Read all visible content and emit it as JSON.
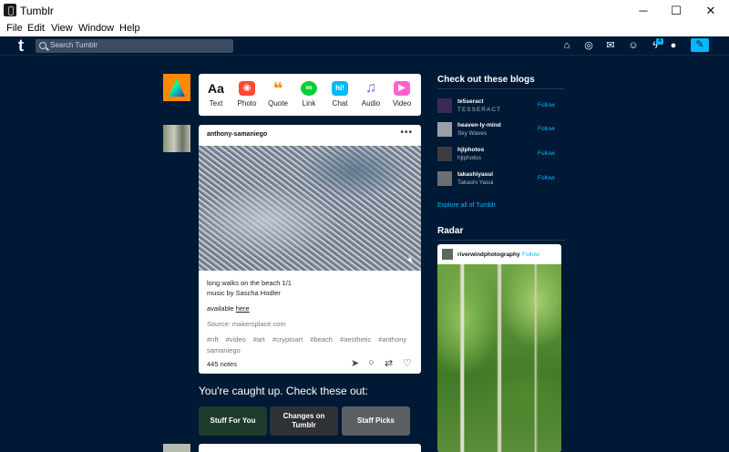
{
  "window": {
    "title": "Tumblr",
    "controls": {
      "minimize": "─",
      "maximize": "☐",
      "close": "✕"
    }
  },
  "menu": [
    "File",
    "Edit",
    "View",
    "Window",
    "Help"
  ],
  "topbar": {
    "logo": "t",
    "search_placeholder": "Search Tumblr",
    "nav_icons": [
      "home-icon",
      "explore-icon",
      "inbox-icon",
      "messages-icon",
      "activity-icon",
      "account-icon",
      "compose-icon"
    ],
    "activity_badge": "4"
  },
  "composer": {
    "items": [
      {
        "label": "Text",
        "glyph": "Aa",
        "color": "#111111"
      },
      {
        "label": "Photo",
        "glyph": "◉",
        "color": "#ff4930"
      },
      {
        "label": "Quote",
        "glyph": "❝",
        "color": "#ff8a00"
      },
      {
        "label": "Link",
        "glyph": "∞",
        "color": "#00cf35"
      },
      {
        "label": "Chat",
        "glyph": "hi!",
        "color": "#00b8ff"
      },
      {
        "label": "Audio",
        "glyph": "♫",
        "color": "#7c5cff"
      },
      {
        "label": "Video",
        "glyph": "▶",
        "color": "#ff62ce"
      }
    ]
  },
  "post": {
    "username": "anthony-samaniego",
    "line1": "long walks on the beach 1/1",
    "line2": "music by Sascha Hodler",
    "available_prefix": "available",
    "available_link": "here",
    "source": "Source: makersplace.com",
    "tags": [
      "#nft",
      "#video",
      "#art",
      "#cryptoart",
      "#beach",
      "#aesthetic",
      "#anthony samaniego"
    ],
    "notes": "445 notes"
  },
  "caught_up": {
    "heading": "You're caught up. Check these out:",
    "cards": [
      {
        "label": "Stuff For You",
        "color": "#1f3b2c"
      },
      {
        "label": "Changes on Tumblr",
        "color": "#2e3136"
      },
      {
        "label": "Staff Picks",
        "color": "#5c5f64"
      }
    ]
  },
  "sidebar": {
    "blogs_heading": "Check out these blogs",
    "blogs": [
      {
        "name": "te5seract",
        "title": "TESSERACT",
        "follow": "Follow",
        "color": "#3a2a5a"
      },
      {
        "name": "heaven-ly-mind",
        "title": "Sky Waves",
        "follow": "Follow",
        "color": "#9aa0a6"
      },
      {
        "name": "hjlphotos",
        "title": "hjlphotos",
        "follow": "Follow",
        "color": "#3b3d40"
      },
      {
        "name": "takashiyasui",
        "title": "Takashi Yasui",
        "follow": "Follow",
        "color": "#6b6f74"
      }
    ],
    "explore": "Explore all of Tumblr",
    "radar_heading": "Radar",
    "radar": {
      "username": "riverwindphotography",
      "follow": "Follow"
    }
  }
}
